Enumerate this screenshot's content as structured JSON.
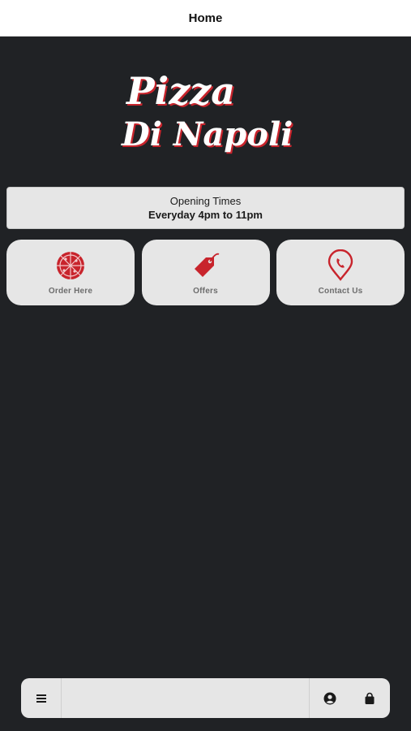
{
  "header": {
    "title": "Home"
  },
  "logo": {
    "line1": "Pizza",
    "line2": "Di Napoli"
  },
  "hours": {
    "title": "Opening Times",
    "text": "Everyday 4pm to 11pm"
  },
  "tiles": [
    {
      "label": "Order Here",
      "icon": "pizza-icon"
    },
    {
      "label": "Offers",
      "icon": "tag-icon"
    },
    {
      "label": "Contact Us",
      "icon": "phone-pin-icon"
    }
  ],
  "bottom_nav": {
    "menu_icon": "hamburger-menu-icon",
    "account_icon": "account-icon",
    "bag_icon": "shopping-bag-icon"
  },
  "colors": {
    "background": "#202225",
    "accent": "#c8242c",
    "tile": "#e6e6e6"
  }
}
